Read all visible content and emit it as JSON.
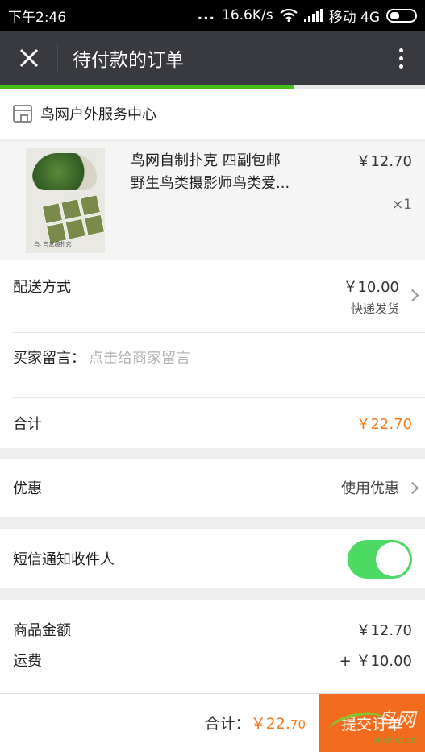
{
  "status_bar": {
    "time": "下午2:46",
    "dots": "...",
    "speed": "16.6K/s",
    "carrier": "移动 4G"
  },
  "nav": {
    "title": "待付款的订单",
    "close_icon": "close-icon",
    "more_icon": "more-vertical-icon"
  },
  "page_progress": 0.69,
  "store": {
    "name": "鸟网户外服务中心",
    "icon": "store-icon"
  },
  "product": {
    "name_line1": "鸟网自制扑克 四副包邮",
    "name_line2": "野生鸟类摄影师鸟类爱...",
    "price": "￥12.70",
    "qty": "×1",
    "thumb_caption": "鸟. 鸟友趣扑克"
  },
  "shipping": {
    "label": "配送方式",
    "price": "￥10.00",
    "method": "快递发货"
  },
  "message": {
    "label": "买家留言：",
    "placeholder": "点击给商家留言"
  },
  "subtotal": {
    "label": "合计",
    "value": "￥22.70"
  },
  "coupon": {
    "label": "优惠",
    "value": "使用优惠"
  },
  "sms": {
    "label": "短信通知收件人",
    "enabled": true
  },
  "summary": {
    "goods_label": "商品金额",
    "goods_value": "￥12.70",
    "freight_label": "运费",
    "freight_value": "+ ￥10.00"
  },
  "bottom": {
    "total_label": "合计：",
    "total_main": "￥22.",
    "total_cents": "70",
    "submit_label": "提交订单"
  },
  "watermark": {
    "cn": "鸟网",
    "url": "birdnet.cn"
  },
  "colors": {
    "accent": "#f37b1d",
    "toggle_on": "#4cd964",
    "navbar": "#393a3f",
    "progress": "#45c01a"
  }
}
